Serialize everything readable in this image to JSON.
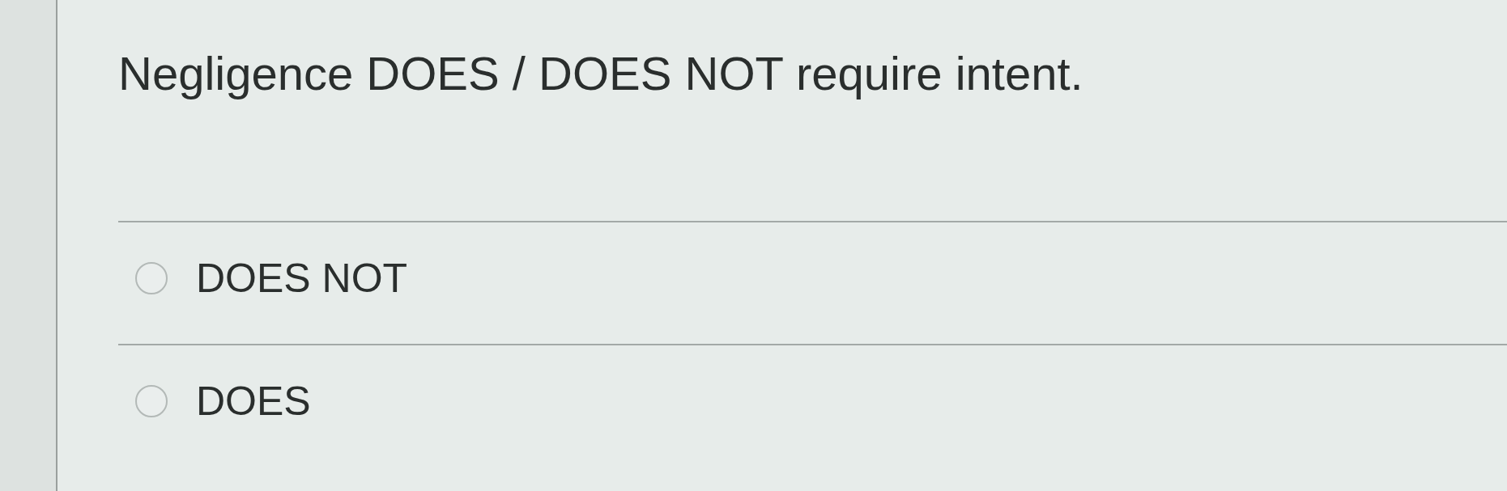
{
  "question": {
    "text": "Negligence DOES / DOES NOT require intent."
  },
  "options": [
    {
      "label": "DOES NOT",
      "selected": false
    },
    {
      "label": "DOES",
      "selected": false
    }
  ]
}
